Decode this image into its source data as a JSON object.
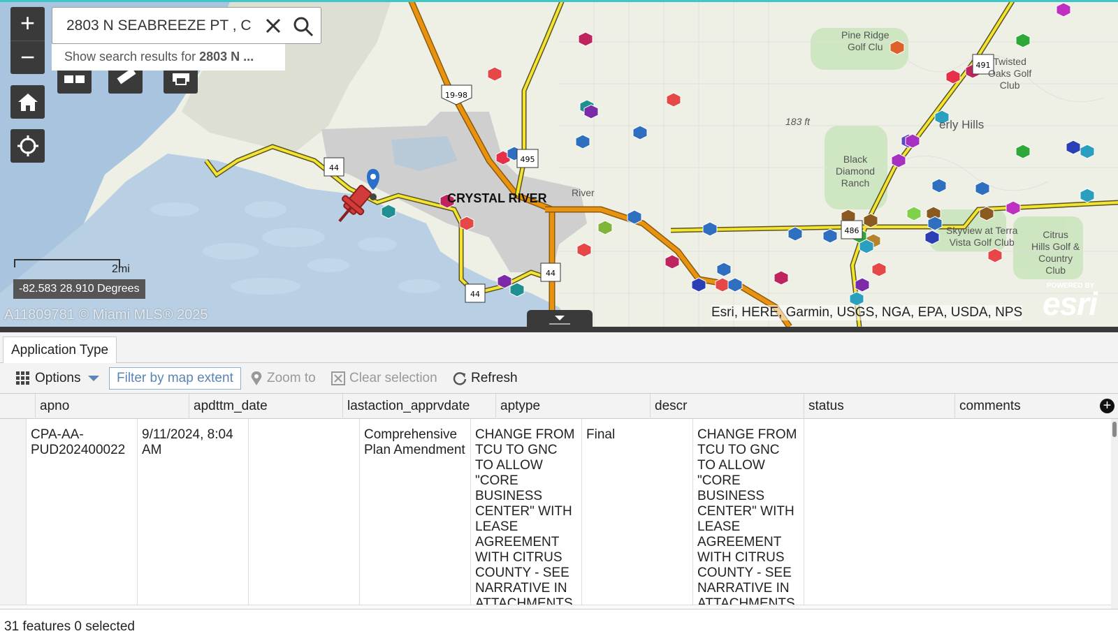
{
  "search": {
    "value": "2803 N SEABREEZE PT , C",
    "suggestion_prefix": "Show search results for ",
    "suggestion_bold": "2803 N ..."
  },
  "zoom": {
    "in_label": "+",
    "out_label": "−"
  },
  "map": {
    "scale_label": "2mi",
    "coordinates": "-82.583 28.910 Degrees",
    "watermark": "A11809781 © Miami MLS® 2025",
    "attribution": "Esri, HERE, Garmin, USGS, NGA, EPA, USDA, NPS",
    "esri_powered": "POWERED BY",
    "esri_logo": "esri",
    "city": "CRYSTAL RIVER",
    "labels": {
      "pine_ridge": "Pine Ridge\nGolf Clu",
      "twisted_oaks": "Twisted\nOaks Golf\nClub",
      "elevation": "183 ft",
      "beverly_hills": "erly Hills",
      "black_diamond": "Black\nDiamond\nRanch",
      "skyview": "Skyview at Terra\nVista Golf Club",
      "citrus_hills": "Citrus\nHills Golf &\nCountry\nClub",
      "river": "River"
    },
    "route_shields": [
      "19-98",
      "44",
      "495",
      "44",
      "44",
      "491",
      "486"
    ],
    "colors": {
      "water": "#a9c4de",
      "land": "#eef0e6",
      "urban": "#cfcfcf",
      "highway": "#e8920e",
      "road": "#f2e430",
      "pin": "#d33b3b"
    }
  },
  "panel": {
    "tab_label": "Application Type",
    "toolbar": {
      "options": "Options",
      "filter": "Filter by map extent",
      "zoom_to": "Zoom to",
      "clear_selection": "Clear selection",
      "refresh": "Refresh"
    },
    "columns": [
      "apno",
      "apdttm_date",
      "lastaction_apprvdate",
      "aptype",
      "descr",
      "status",
      "comments"
    ],
    "rows": [
      {
        "apno": "CPA-AA-PUD202400022",
        "apdttm_date": "9/11/2024, 8:04 AM",
        "lastaction_apprvdate": "",
        "aptype": "Comprehensive Plan Amendment",
        "descr": "CHANGE FROM TCU TO GNC TO ALLOW \"CORE BUSINESS CENTER\" WITH LEASE AGREEMENT WITH CITRUS COUNTY - SEE NARRATIVE IN ATTACHMENTS",
        "status": "Final",
        "comments": "CHANGE FROM TCU TO GNC TO ALLOW \"CORE BUSINESS CENTER\" WITH LEASE AGREEMENT WITH CITRUS COUNTY - SEE NARRATIVE IN ATTACHMENTS"
      }
    ],
    "status_text": "31 features 0 selected"
  }
}
